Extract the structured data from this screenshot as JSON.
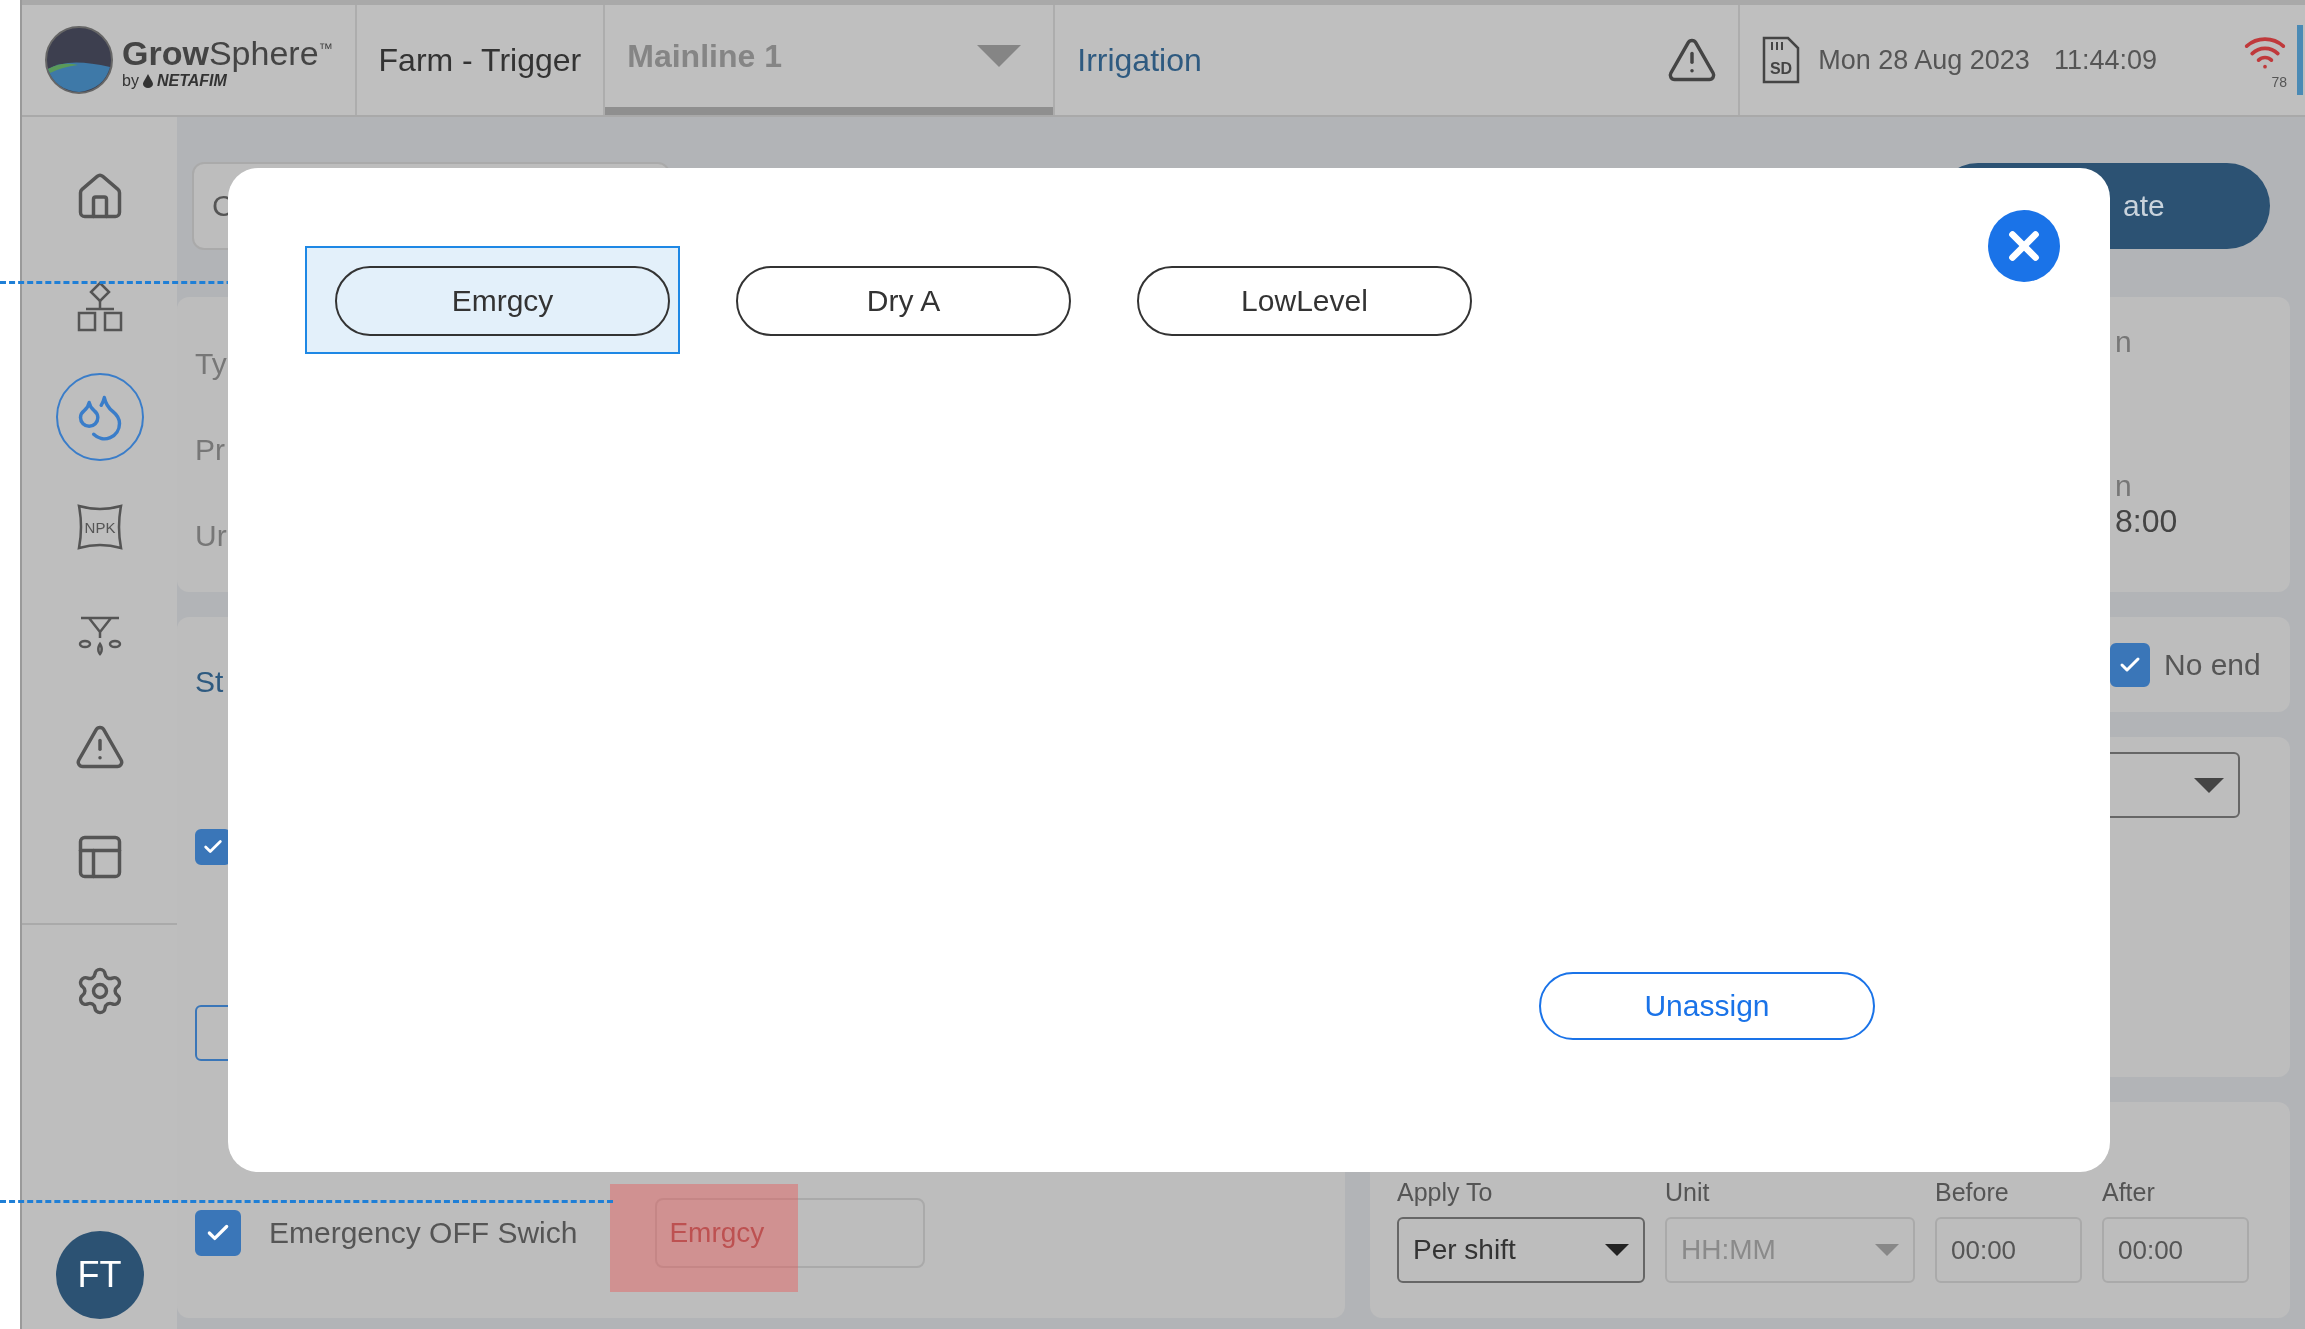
{
  "header": {
    "logo": {
      "name": "**Grow**Sphere$^{™}$",
      "by": "by",
      "brand": "NETAFIM"
    },
    "farm": "Farm - Trigger",
    "mainline": "Mainline 1",
    "section": "Irrigation",
    "storage_label": "SD",
    "date": "Mon 28 Aug 2023",
    "time": "11:44:09",
    "signal_value": "78"
  },
  "sidebar": {
    "items": [
      {
        "kind": "home",
        "selected": false
      },
      {
        "kind": "hierarchy",
        "selected": false
      },
      {
        "kind": "irrigation",
        "selected": true
      },
      {
        "kind": "fertilizer",
        "label": "NPK",
        "selected": false
      },
      {
        "kind": "sprinkler",
        "selected": false
      },
      {
        "kind": "alarm",
        "selected": false
      },
      {
        "kind": "table",
        "selected": false
      },
      {
        "kind": "settings",
        "selected": false
      }
    ],
    "avatar": "FT"
  },
  "background": {
    "search": {
      "value": "C"
    },
    "action_button": "ate",
    "details_card": {
      "left_labels": [
        "Ty",
        "Pr",
        "Ur"
      ],
      "right_items": [
        {
          "label": "n"
        },
        {
          "label": "n",
          "value": "8:00"
        }
      ]
    },
    "schedule_card": {
      "title": "St",
      "checked": true
    },
    "no_end": {
      "label": "No end",
      "checked": true
    },
    "emergency": {
      "checked": true,
      "label": "Emergency OFF Swich",
      "value": "Emrgcy",
      "highlighted": true
    },
    "timing": [
      {
        "kind": "select",
        "label": "Apply To",
        "value": "Per shift",
        "disabled": false
      },
      {
        "kind": "select",
        "label": "Unit",
        "value": "HH:MM",
        "disabled": true
      },
      {
        "kind": "text",
        "label": "Before",
        "value": "00:00",
        "disabled": false
      },
      {
        "kind": "text",
        "label": "After",
        "value": "00:00",
        "disabled": false
      }
    ]
  },
  "modal": {
    "tags": [
      {
        "label": "Emrgcy",
        "selected": true
      },
      {
        "label": "Dry A",
        "selected": false
      },
      {
        "label": "LowLevel",
        "selected": false
      }
    ],
    "unassign": "Unassign"
  }
}
